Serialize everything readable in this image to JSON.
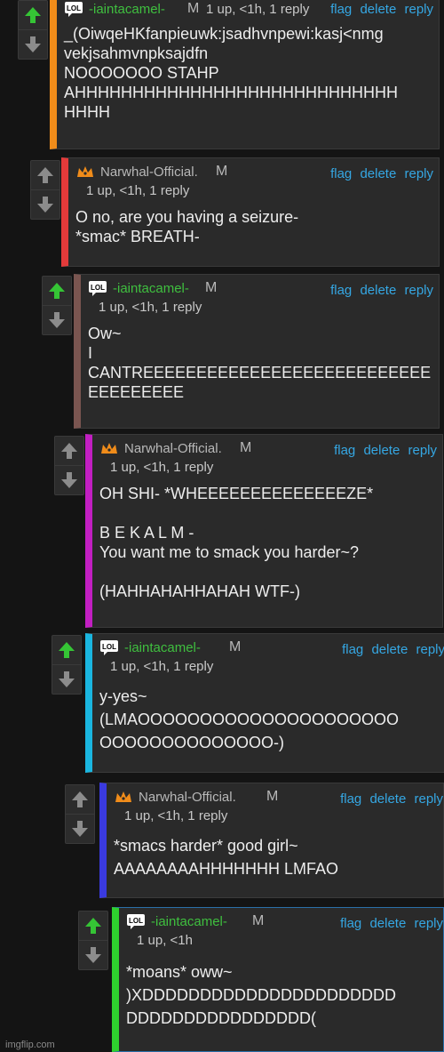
{
  "actions": {
    "flag": "flag",
    "delete": "delete",
    "reply": "reply"
  },
  "comments": [
    {
      "user": "-iaintacamel-",
      "badge": "LOL",
      "mod": "M",
      "meta": "1 up, <1h, 1 reply",
      "text": "_(OiwqeHKfanpieuwk:jsadhvnpewi:kasj<nmg\nvekjsahmvnpksajdfn\nNOOOOOOO STAHP\nAHHHHHHHHHHHHHHHHHHHHHHHHHHHH\nHHHH",
      "accent": "#f08c1a"
    },
    {
      "user": "Narwhal-Official.",
      "badge": "crown",
      "mod": "M",
      "meta": "1 up, <1h, 1 reply",
      "text": "O no, are you having a seizure-\n*smac* BREATH-",
      "accent": "#e33a3a"
    },
    {
      "user": "-iaintacamel-",
      "badge": "LOL",
      "mod": "M",
      "meta": "1 up, <1h, 1 reply",
      "text": "Ow~\nI\nCANTREEEEEEEEEEEEEEEEEEEEEEEEEEE\nEEEEEEEEE",
      "accent": "#7a5550"
    },
    {
      "user": "Narwhal-Official.",
      "badge": "crown",
      "mod": "M",
      "meta": "1 up, <1h, 1 reply",
      "text": "OH SHI- *WHEEEEEEEEEEEEEEZE*\n\nB E K A L M -\nYou want me to smack you harder~?\n\n(HAHHAHAHHAHAH WTF-)",
      "accent": "#c21fc2"
    },
    {
      "user": "-iaintacamel-",
      "badge": "LOL",
      "mod": "M",
      "meta": "1 up, <1h, 1 reply",
      "text": "y-yes~\n(LMAOOOOOOOOOOOOOOOOOOOOO\nOOOOOOOOOOOOOO-)",
      "accent": "#1ab6e0"
    },
    {
      "user": "Narwhal-Official.",
      "badge": "crown",
      "mod": "M",
      "meta": "1 up, <1h, 1 reply",
      "text": "*smacs harder* good girl~\nAAAAAAAAHHHHHHH LMFAO",
      "accent": "#3a3ae0"
    },
    {
      "user": "-iaintacamel-",
      "badge": "LOL",
      "mod": "M",
      "meta": "1 up, <1h",
      "text": "*moans* oww~\n)XDDDDDDDDDDDDDDDDDDDDDD\nDDDDDDDDDDDDDDDD(",
      "accent": "#2ed12e"
    }
  ],
  "icons": {
    "upvote": "arrow-up-icon",
    "downvote": "arrow-down-icon",
    "lol": "lol-badge-icon",
    "crown": "crown-badge-icon"
  },
  "watermark": "imgflip.com"
}
